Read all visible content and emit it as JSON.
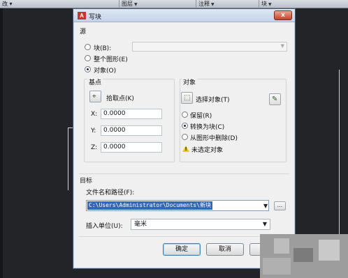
{
  "ribbon": {
    "items": [
      {
        "label": "改 ▾"
      },
      {
        "label": "图层"
      },
      {
        "label": "注释"
      },
      {
        "label": "块"
      }
    ]
  },
  "dialog": {
    "title": "写块",
    "app_icon_text": "A",
    "close_label": "x",
    "source": {
      "heading": "源",
      "block_label": "块(B):",
      "block_value": "",
      "whole_drawing_label": "整个图形(E)",
      "objects_label": "对象(O)",
      "selected": "objects"
    },
    "base_point": {
      "heading": "基点",
      "pick_label": "拾取点(K)",
      "x_label": "X:",
      "x_value": "0.0000",
      "y_label": "Y:",
      "y_value": "0.0000",
      "z_label": "Z:",
      "z_value": "0.0000"
    },
    "objects": {
      "heading": "对象",
      "select_label": "选择对象(T)",
      "retain_label": "保留(R)",
      "convert_label": "转换为块(C)",
      "delete_label": "从图形中删除(D)",
      "selected": "convert",
      "warning_text": "未选定对象"
    },
    "target": {
      "heading": "目标",
      "path_label": "文件名和路径(F):",
      "path_value": "C:\\Users\\Administrator\\Documents\\新块",
      "browse_label": "...",
      "units_label": "插入单位(U):",
      "units_value": "毫米"
    },
    "buttons": {
      "ok": "确定",
      "cancel": "取消",
      "help": "帮助"
    }
  },
  "colors": {
    "background": "#1e2023",
    "dialog_bg": "#f0f0f0",
    "selection": "#3368b6",
    "close_button": "#c4412b"
  }
}
